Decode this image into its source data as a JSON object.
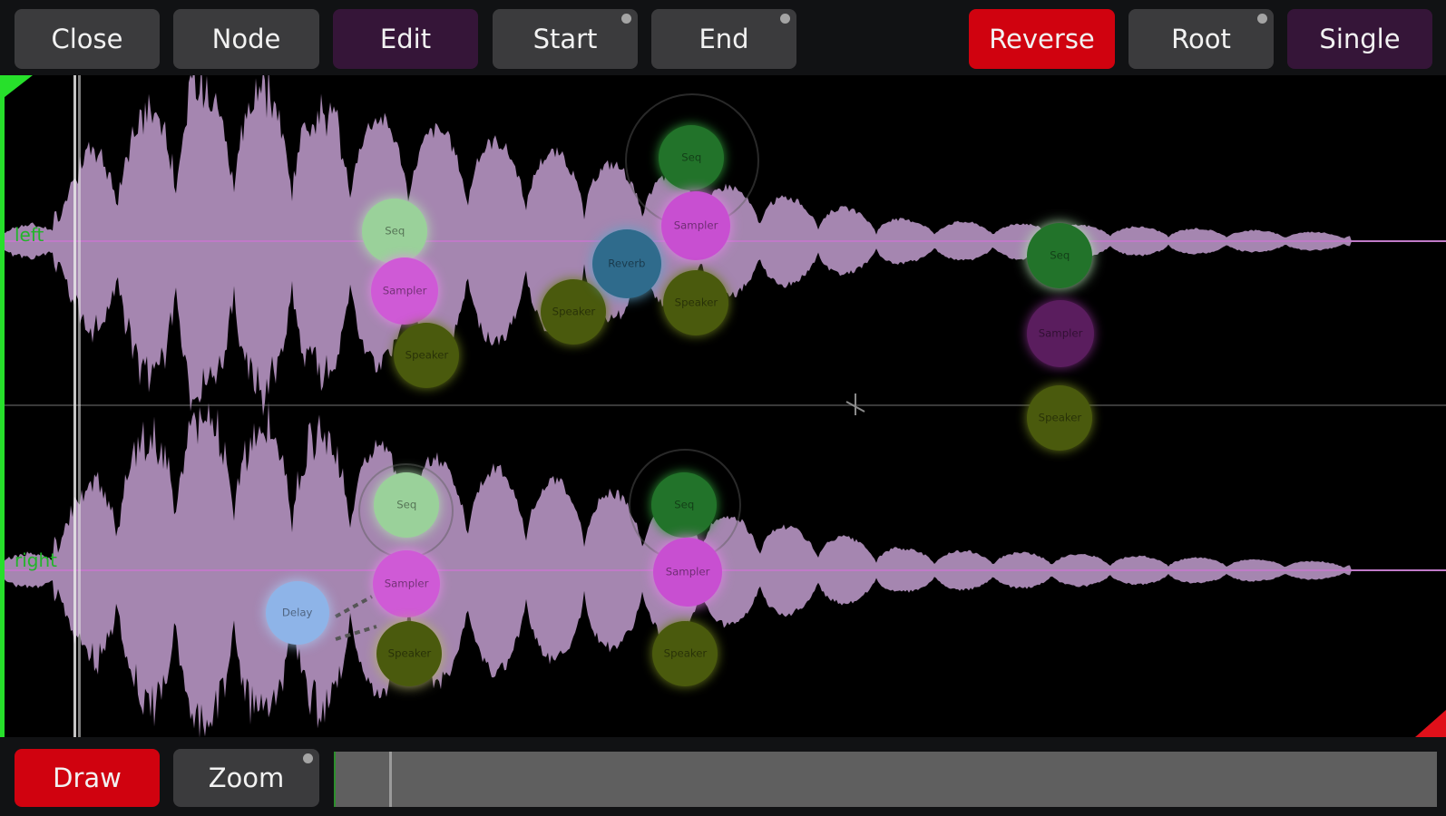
{
  "toolbar": {
    "close": "Close",
    "node": "Node",
    "edit": "Edit",
    "start": "Start",
    "end": "End",
    "reverse": "Reverse",
    "root": "Root",
    "single": "Single"
  },
  "bottom": {
    "draw": "Draw",
    "zoom": "Zoom"
  },
  "channels": {
    "left": "left",
    "right": "right"
  },
  "nodes": {
    "seq": "Seq",
    "sampler": "Sampler",
    "speaker": "Speaker",
    "reverb": "Reverb",
    "delay": "Delay"
  },
  "colors": {
    "accent_red": "#d0020f",
    "button_gray": "#3b3b3d",
    "button_purple": "#351538",
    "waveform": "#a586b0",
    "channel_label": "#22b52a"
  },
  "scroll": {
    "position_fraction": 0.05
  }
}
